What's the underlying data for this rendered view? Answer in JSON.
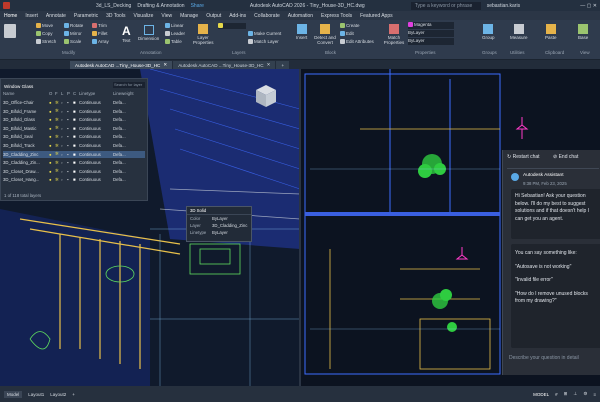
{
  "titlebar": {
    "tabs": [
      "3d_LS_Decking",
      "Drafting & Annotation",
      "Share"
    ],
    "title": "Autodesk AutoCAD 2026 - Tiny_House-3D_HC.dwg",
    "search_placeholder": "Type a keyword or phrase",
    "user": "sebastian.karis"
  },
  "menubar": {
    "items": [
      "Home",
      "Insert",
      "Annotate",
      "Parametric",
      "3D Tools",
      "Visualize",
      "View",
      "Manage",
      "Output",
      "Add-ins",
      "Collaborate",
      "Automation",
      "Express Tools",
      "Featured Apps"
    ]
  },
  "ribbon": {
    "draw": [
      "Move",
      "Rotate",
      "Trim",
      "Copy",
      "Mirror",
      "Fillet",
      "Stretch",
      "Scale",
      "Array"
    ],
    "annotation": [
      "Text",
      "Dimension",
      "Linear",
      "Leader",
      "Table"
    ],
    "layers": [
      "Layer Properties",
      "Make Current",
      "Match Layer"
    ],
    "block": [
      "Insert",
      "Detect and Convert",
      "Create",
      "Edit",
      "Edit Attributes"
    ],
    "properties": [
      "Match Properties",
      "Magenta",
      "ByLayer",
      "ByLayer",
      "ByLayer"
    ],
    "groups": "Group",
    "utilities": "Measure",
    "clipboard": "Paste",
    "view": "Base",
    "groups_labels": [
      "Modify",
      "Annotation",
      "Layers",
      "Block",
      "Properties",
      "Groups",
      "Utilities",
      "Clipboard",
      "View"
    ]
  },
  "doc_tabs": [
    "Autodesk AutoCAD ...Tiny_House-3D_HC",
    "Autodesk AutoCAD ...Tiny_House-3D_HC"
  ],
  "layer_panel": {
    "title": "Window Glass",
    "search_placeholder": "Search for layer",
    "headers": [
      "Name",
      "O",
      "F",
      "L",
      "P",
      "C",
      "Linetype",
      "Lineweight"
    ],
    "rows": [
      {
        "name": "3D_Office-Chair",
        "lt": "Continuous",
        "lw": "Defa..."
      },
      {
        "name": "3D_Bifold_Frame",
        "lt": "Continuous",
        "lw": "Defa..."
      },
      {
        "name": "3D_Bifold_Glass",
        "lt": "Continuous",
        "lw": "Defa..."
      },
      {
        "name": "3D_Bifold_Mastic",
        "lt": "Continuous",
        "lw": "Defa..."
      },
      {
        "name": "3D_Bifold_Seal",
        "lt": "Continuous",
        "lw": "Defa..."
      },
      {
        "name": "3D_Bifold_Track",
        "lt": "Continuous",
        "lw": "Defa..."
      },
      {
        "name": "3D_Cladding_Zinc",
        "lt": "Continuous",
        "lw": "Defa...",
        "selected": true
      },
      {
        "name": "3D_Cladding_Zin...",
        "lt": "Continuous",
        "lw": "Defa..."
      },
      {
        "name": "3D_Closet_Draw...",
        "lt": "Continuous",
        "lw": "Defa..."
      },
      {
        "name": "3D_Closet_Hang...",
        "lt": "Continuous",
        "lw": "Defa..."
      }
    ],
    "footer": "1 of 118 total layers"
  },
  "props_popup": {
    "title": "3D Solid",
    "rows": [
      [
        "Color",
        "ByLayer"
      ],
      [
        "Layer",
        "3D_Cladding_Zinc"
      ],
      [
        "Linetype",
        "ByLayer"
      ]
    ]
  },
  "chat": {
    "restart": "Restart chat",
    "end": "End chat",
    "sender": "Autodesk Assistant",
    "time": "9:38 PM, Feb 23, 2025",
    "greeting": "Hi Sebastian! Ask your question below. I'll do my best to suggest solutions and if that doesn't help I can get you an agent.",
    "suggest_intro": "You can say something like:",
    "suggestions": [
      "\"Autosave is not working\"",
      "\"Invalid file error\"",
      "\"How do I remove unused blocks from my drawing?\""
    ],
    "input_placeholder": "Describe your question in detail"
  },
  "statusbar": {
    "left": "Layout1",
    "tabs": [
      "Model",
      "Layout1",
      "Layout2"
    ],
    "right": "MODEL"
  }
}
